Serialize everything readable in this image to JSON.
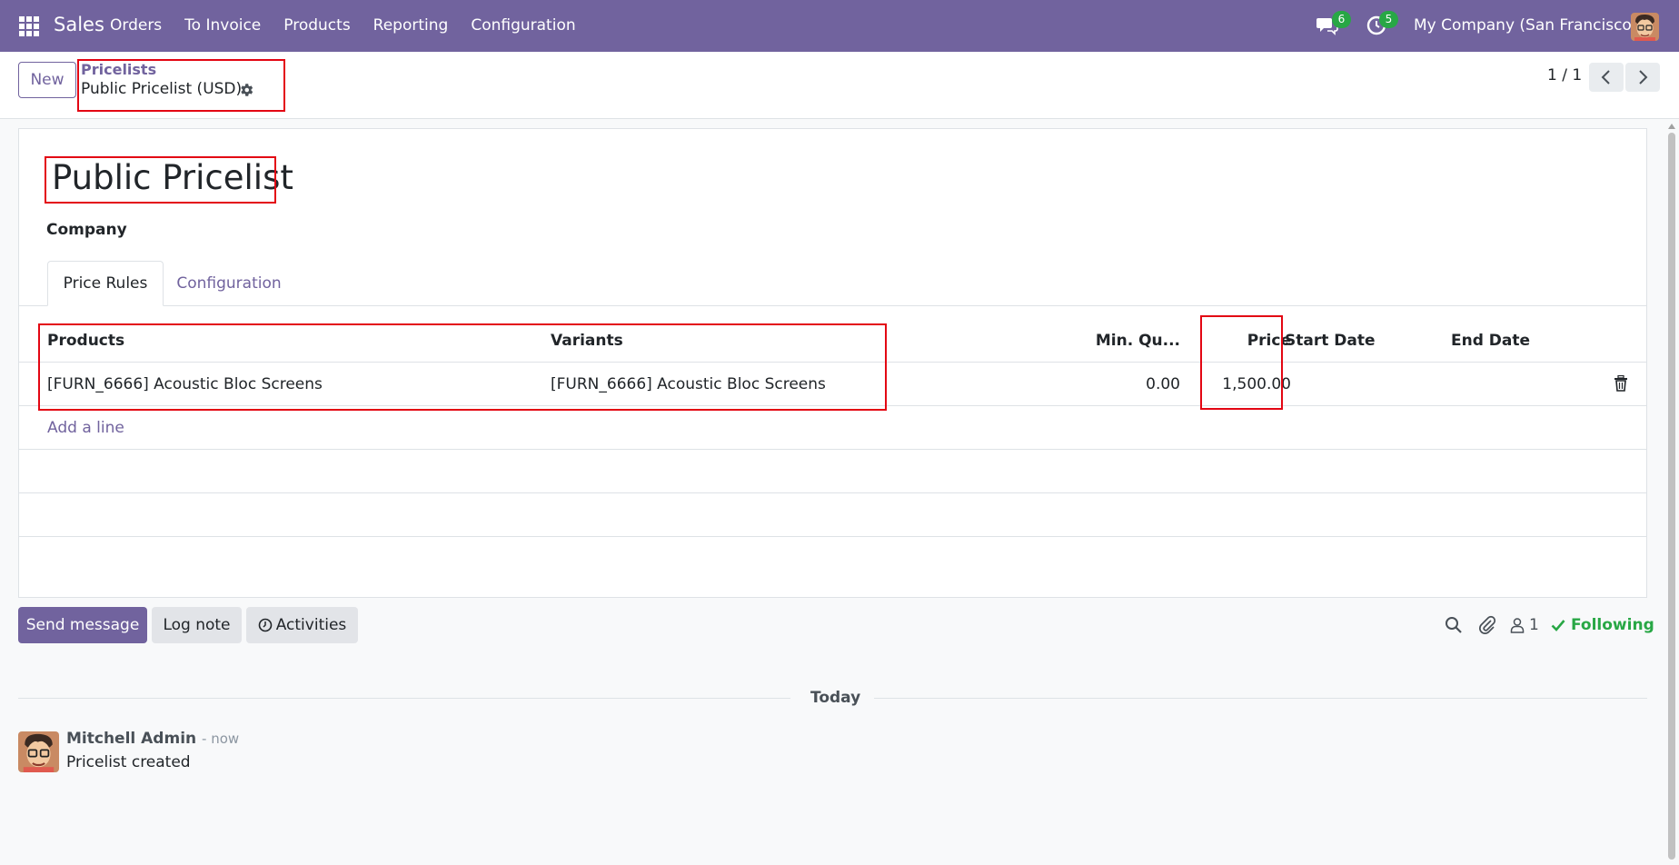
{
  "nav": {
    "brand": "Sales",
    "menu": [
      "Orders",
      "To Invoice",
      "Products",
      "Reporting",
      "Configuration"
    ],
    "messages_count": "6",
    "activities_count": "5",
    "company": "My Company (San Francisco)"
  },
  "control": {
    "new_label": "New",
    "breadcrumb": "Pricelists",
    "record": "Public Pricelist (USD)",
    "pager": "1 / 1"
  },
  "form": {
    "title": "Public Pricelist",
    "company_label": "Company",
    "tabs": [
      "Price Rules",
      "Configuration"
    ],
    "columns": {
      "products": "Products",
      "variants": "Variants",
      "min_qty": "Min. Qu...",
      "price": "Price",
      "start_date": "Start Date",
      "end_date": "End Date"
    },
    "rows": [
      {
        "product": "[FURN_6666] Acoustic Bloc Screens",
        "variant": "[FURN_6666] Acoustic Bloc Screens",
        "min_qty": "0.00",
        "price": "1,500.00",
        "start_date": "",
        "end_date": ""
      }
    ],
    "add_line": "Add a line"
  },
  "chatter": {
    "send_message": "Send message",
    "log_note": "Log note",
    "activities": "Activities",
    "followers_count": "1",
    "following": "Following",
    "date_separator": "Today",
    "messages": [
      {
        "author": "Mitchell Admin",
        "time": "- now",
        "body": "Pricelist created"
      }
    ]
  },
  "colors": {
    "brand": "#71639e",
    "success": "#28a745",
    "highlight": "#e30613"
  }
}
